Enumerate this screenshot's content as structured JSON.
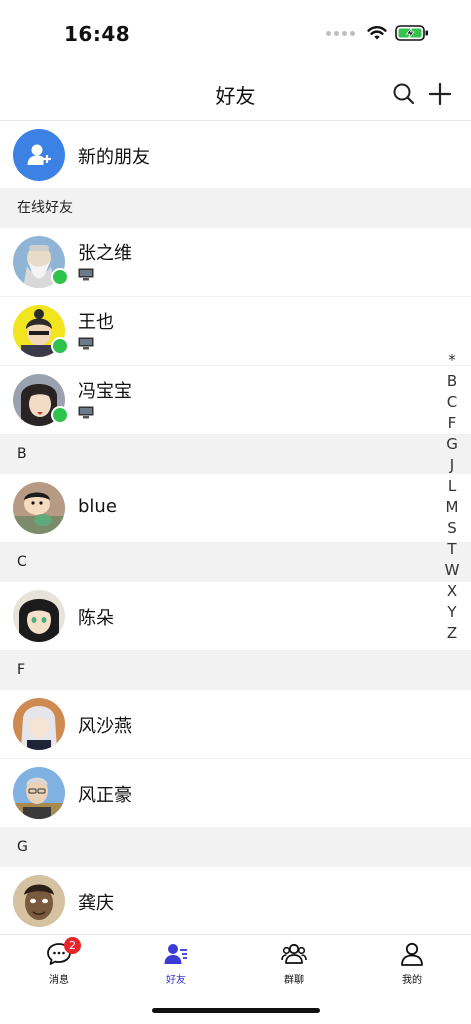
{
  "status_bar": {
    "time": "16:48"
  },
  "nav": {
    "title": "好友"
  },
  "new_friends": {
    "label": "新的朋友"
  },
  "sections": {
    "online": "在线好友",
    "b": "B",
    "c": "C",
    "f": "F",
    "g": "G"
  },
  "friends": {
    "zhang": {
      "name": "张之维"
    },
    "wang": {
      "name": "王也"
    },
    "feng_bao": {
      "name": "冯宝宝"
    },
    "blue": {
      "name": "blue"
    },
    "chen": {
      "name": "陈朵"
    },
    "feng_sha": {
      "name": "风沙燕"
    },
    "feng_zheng": {
      "name": "风正豪"
    },
    "gong": {
      "name": "龚庆"
    }
  },
  "index": [
    "*",
    "B",
    "C",
    "F",
    "G",
    "J",
    "L",
    "M",
    "S",
    "T",
    "W",
    "X",
    "Y",
    "Z"
  ],
  "tabs": {
    "messages": {
      "label": "消息",
      "badge": "2"
    },
    "friends": {
      "label": "好友"
    },
    "groups": {
      "label": "群聊"
    },
    "me": {
      "label": "我的"
    }
  },
  "colors": {
    "accent": "#3b3bd6",
    "online": "#2ec44b",
    "new_friend_bg": "#3b82e4",
    "badge": "#e8262b",
    "section_bg": "#f2f2f2"
  }
}
